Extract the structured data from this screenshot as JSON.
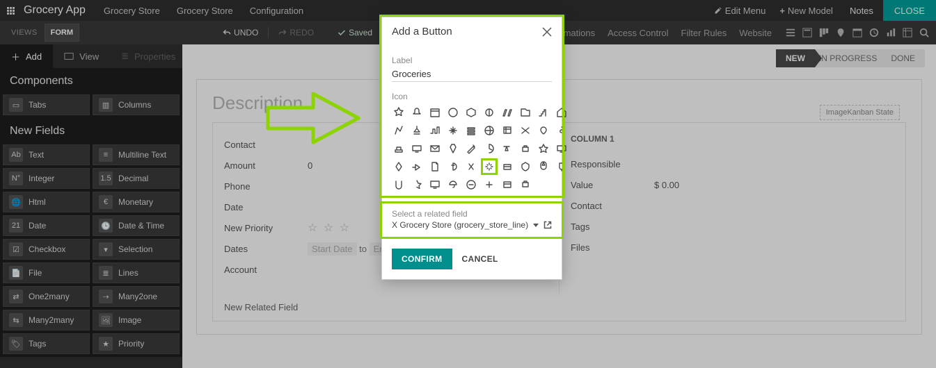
{
  "topbar": {
    "app_title": "Grocery App",
    "links": [
      "Grocery Store",
      "Grocery Store",
      "Configuration"
    ],
    "edit_menu": "Edit Menu",
    "new_model": "New Model",
    "notes": "Notes",
    "close": "CLOSE"
  },
  "subbar": {
    "views_label": "VIEWS",
    "form_label": "FORM",
    "undo": "UNDO",
    "redo": "REDO",
    "saved": "Saved",
    "right_text": [
      "Automations",
      "Access Control",
      "Filter Rules",
      "Website"
    ]
  },
  "sidebar": {
    "tabs": {
      "add": "Add",
      "view": "View",
      "properties": "Properties"
    },
    "components_heading": "Components",
    "components": [
      "Tabs",
      "Columns"
    ],
    "new_fields_heading": "New Fields",
    "fields": [
      {
        "ico": "Ab",
        "label": "Text"
      },
      {
        "ico": "≡",
        "label": "Multiline Text"
      },
      {
        "ico": "N°",
        "label": "Integer"
      },
      {
        "ico": "1.5",
        "label": "Decimal"
      },
      {
        "ico": "🌐",
        "label": "Html"
      },
      {
        "ico": "€",
        "label": "Monetary"
      },
      {
        "ico": "21",
        "label": "Date"
      },
      {
        "ico": "🕒",
        "label": "Date & Time"
      },
      {
        "ico": "☑",
        "label": "Checkbox"
      },
      {
        "ico": "▾",
        "label": "Selection"
      },
      {
        "ico": "📄",
        "label": "File"
      },
      {
        "ico": "≣",
        "label": "Lines"
      },
      {
        "ico": "⇄",
        "label": "One2many"
      },
      {
        "ico": "⇢",
        "label": "Many2one"
      },
      {
        "ico": "⇆",
        "label": "Many2many"
      },
      {
        "ico": "🖼",
        "label": "Image"
      },
      {
        "ico": "🏷",
        "label": "Tags"
      },
      {
        "ico": "★",
        "label": "Priority"
      }
    ]
  },
  "main": {
    "stages": [
      "NEW",
      "IN PROGRESS",
      "DONE"
    ],
    "description_title": "Description",
    "kanban_tag": "ImageKanban State",
    "col2_heading": "COLUMN 1",
    "left_rows": [
      {
        "label": "Contact",
        "value": ""
      },
      {
        "label": "Amount",
        "value": "0"
      },
      {
        "label": "Phone",
        "value": ""
      },
      {
        "label": "Date",
        "value": ""
      },
      {
        "label": "New Priority",
        "value": "stars"
      },
      {
        "label": "Dates",
        "value": "daterange"
      },
      {
        "label": "Account",
        "value": ""
      }
    ],
    "date_start_ph": "Start Date",
    "date_to": "to",
    "date_end_ph": "End Date",
    "right_rows": [
      {
        "label": "Responsible",
        "value": ""
      },
      {
        "label": "Value",
        "value": "$ 0.00"
      },
      {
        "label": "Contact",
        "value": ""
      },
      {
        "label": "Tags",
        "value": ""
      },
      {
        "label": "Files",
        "value": ""
      }
    ],
    "new_related": "New Related Field"
  },
  "modal": {
    "title": "Add a Button",
    "label_label": "Label",
    "label_value": "Groceries",
    "icon_label": "Icon",
    "rel_label": "Select a related field",
    "rel_value": "X Grocery Store (grocery_store_line)",
    "confirm": "CONFIRM",
    "cancel": "CANCEL",
    "selected_icon_index": 35
  }
}
